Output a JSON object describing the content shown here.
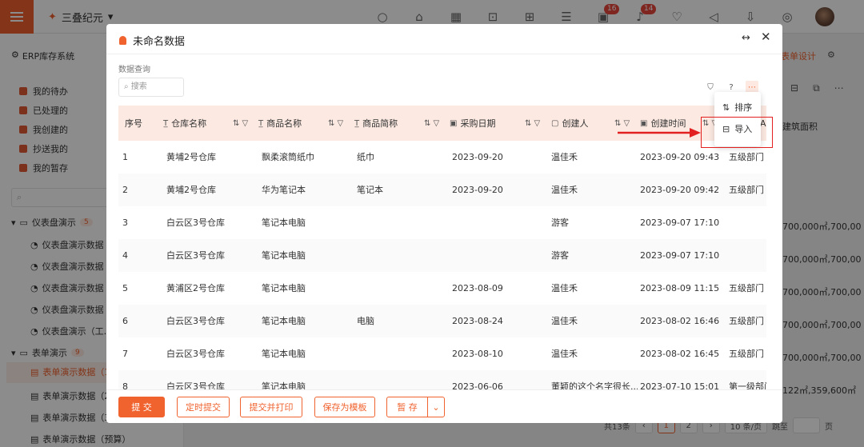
{
  "topbar": {
    "company": "三叠纪元",
    "badges": {
      "tasks": "16",
      "messages": "14"
    }
  },
  "sidebar": {
    "title": "ERP库存系统",
    "items": [
      {
        "label": "我的待办"
      },
      {
        "label": "已处理的"
      },
      {
        "label": "我创建的"
      },
      {
        "label": "抄送我的"
      },
      {
        "label": "我的暂存"
      }
    ],
    "groups": [
      {
        "label": "仪表盘演示",
        "count": "5"
      },
      {
        "label": "表单演示",
        "count": "9"
      }
    ],
    "dashboard_subs": [
      "仪表盘演示数据",
      "仪表盘演示数据",
      "仪表盘演示数据",
      "仪表盘演示数据",
      "仪表盘演示（工..."
    ],
    "form_subs": [
      "表单演示数据（1",
      "表单演示数据（2",
      "表单演示数据（3",
      "表单演示数据（预算）"
    ]
  },
  "background": {
    "form_design": "表单设计",
    "col_header": "建筑面积",
    "col_values": [
      "700,000㎡,700,00",
      "700,000㎡,700,00",
      "700,000㎡,700,00",
      "700,000㎡,700,00",
      "700,000㎡,700,00",
      "122㎡,359,600㎡"
    ],
    "pager": {
      "total": "共13条",
      "p1": "1",
      "p2": "2",
      "size": "10 条/页",
      "goto": "跳至",
      "page": "页"
    }
  },
  "modal": {
    "title": "未命名数据",
    "query_label": "数据查询",
    "search_placeholder": "搜索",
    "columns": [
      "序号",
      "仓库名称",
      "商品名称",
      "商品简称",
      "采购日期",
      "创建人",
      "创建时间",
      "A"
    ],
    "rows": [
      [
        "1",
        "黄埔2号仓库",
        "飘柔滚筒纸巾",
        "纸巾",
        "2023-09-20",
        "温佳禾",
        "2023-09-20 09:43",
        "五级部门"
      ],
      [
        "2",
        "黄埔2号仓库",
        "华为笔记本",
        "笔记本",
        "2023-09-20",
        "温佳禾",
        "2023-09-20 09:42",
        "五级部门"
      ],
      [
        "3",
        "白云区3号仓库",
        "笔记本电脑",
        "",
        "",
        "游客",
        "2023-09-07 17:10",
        ""
      ],
      [
        "4",
        "白云区3号仓库",
        "笔记本电脑",
        "",
        "",
        "游客",
        "2023-09-07 17:10",
        ""
      ],
      [
        "5",
        "黄浦区2号仓库",
        "笔记本电脑",
        "",
        "2023-08-09",
        "温佳禾",
        "2023-08-09 11:15",
        "五级部门"
      ],
      [
        "6",
        "白云区3号仓库",
        "笔记本电脑",
        "电脑",
        "2023-08-24",
        "温佳禾",
        "2023-08-02 16:46",
        "五级部门"
      ],
      [
        "7",
        "白云区3号仓库",
        "笔记本电脑",
        "",
        "2023-08-10",
        "温佳禾",
        "2023-08-02 16:45",
        "五级部门"
      ],
      [
        "8",
        "白云区3号仓库",
        "笔记本电脑",
        "",
        "2023-06-06",
        "董颖的这个名字很长...",
        "2023-07-10 15:01",
        "第一级部门"
      ]
    ],
    "menu": {
      "sort": "排序",
      "import": "导入"
    },
    "footer": {
      "submit": "提 交",
      "scheduled": "定时提交",
      "submit_print": "提交并打印",
      "save_template": "保存为模板",
      "draft": "暂 存"
    }
  },
  "colors": {
    "accent": "#f0622e",
    "highlight": "#e32020"
  }
}
